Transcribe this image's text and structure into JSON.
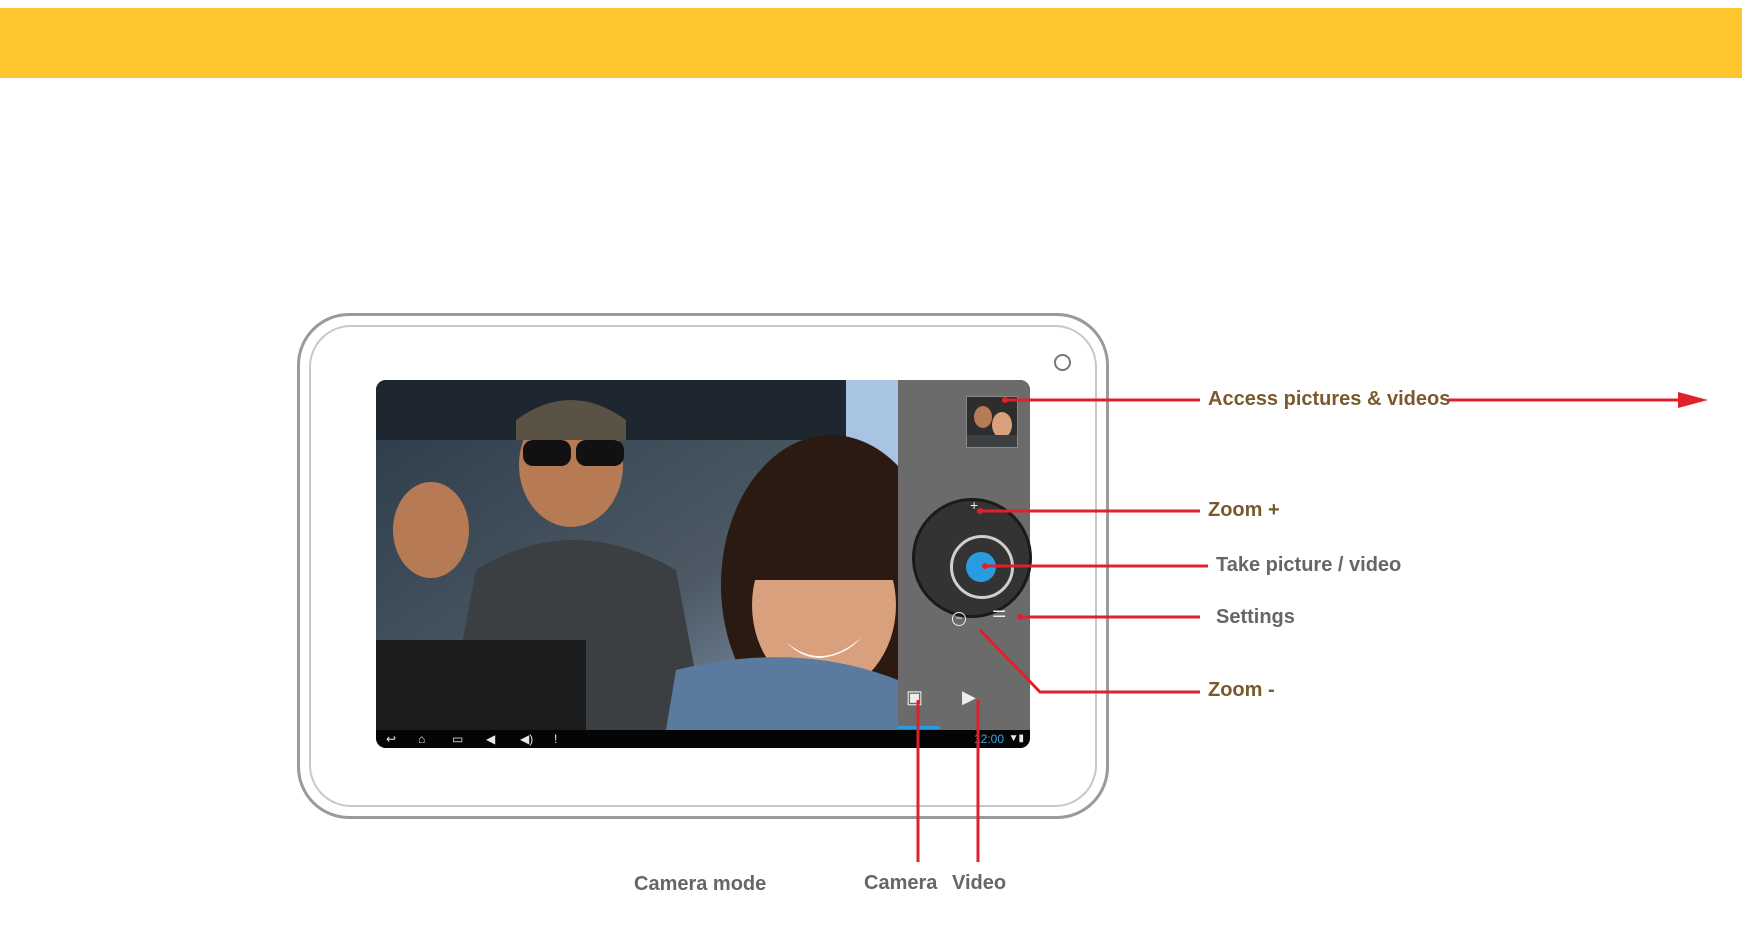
{
  "labels": {
    "access": "Access pictures & videos",
    "zoom_plus": "Zoom +",
    "take": "Take picture / video",
    "settings": "Settings",
    "zoom_minus": "Zoom -",
    "camera_mode": "Camera mode",
    "camera": "Camera",
    "video": "Video"
  },
  "screen": {
    "clock": "12:00"
  },
  "icons": {
    "back": "back-icon",
    "home": "home-icon",
    "recent": "recent-apps-icon",
    "volume_down": "volume-down-icon",
    "volume_up": "volume-up-icon",
    "alert": "alert-icon",
    "wifi": "wifi-icon",
    "battery": "battery-icon",
    "settings": "settings-sliders-icon",
    "camera": "camera-icon",
    "video": "video-camera-icon"
  },
  "colors": {
    "band": "#fec52d",
    "callout": "#e0202a",
    "accent": "#2a9be0"
  }
}
